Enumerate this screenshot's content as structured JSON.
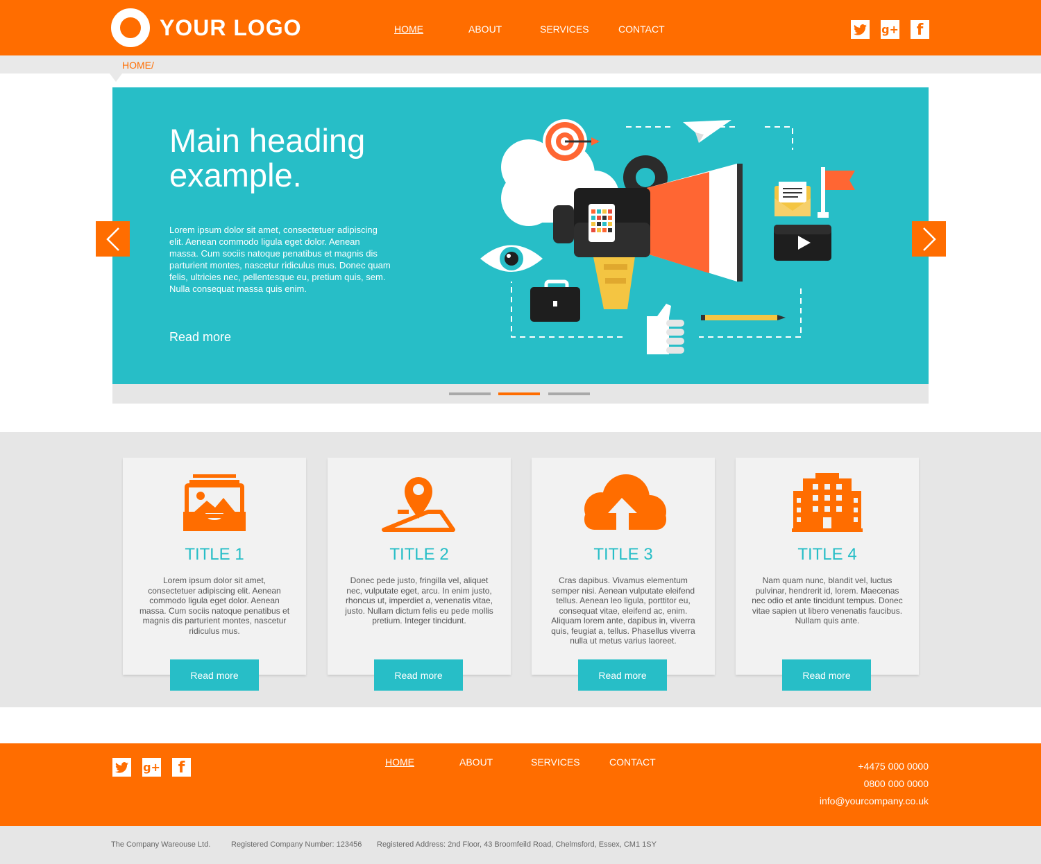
{
  "header": {
    "logo_text": "YOUR LOGO",
    "nav": [
      "HOME",
      "ABOUT",
      "SERVICES",
      "CONTACT"
    ],
    "social_icons": [
      "twitter-icon",
      "google-plus-icon",
      "facebook-icon"
    ]
  },
  "breadcrumb": "HOME/",
  "hero": {
    "heading": "Main heading example.",
    "body": "Lorem ipsum dolor sit amet, consectetuer adipiscing elit. Aenean commodo ligula eget dolor. Aenean massa. Cum sociis natoque penatibus et magnis dis parturient montes, nascetur ridiculus mus. Donec quam felis, ultricies nec, pellentesque eu, pretium quis, sem. Nulla consequat massa quis enim.",
    "read_more": "Read more",
    "slide_count": 3,
    "active_slide": 2
  },
  "features": [
    {
      "title": "TITLE 1",
      "text": "Lorem ipsum dolor sit amet, consectetuer adipiscing elit. Aenean commodo ligula eget dolor. Aenean massa. Cum sociis natoque penatibus et magnis dis parturient montes, nascetur ridiculus mus.",
      "button": "Read more",
      "icon": "photo-archive-icon"
    },
    {
      "title": "TITLE 2",
      "text": "Donec pede justo, fringilla vel, aliquet nec, vulputate eget, arcu. In enim justo, rhoncus ut, imperdiet a, venenatis vitae, justo. Nullam dictum felis eu pede mollis pretium. Integer tincidunt.",
      "button": "Read more",
      "icon": "map-pin-icon"
    },
    {
      "title": "TITLE 3",
      "text": "Cras dapibus. Vivamus elementum semper nisi. Aenean vulputate eleifend tellus. Aenean leo ligula, porttitor eu, consequat vitae, eleifend ac, enim. Aliquam lorem ante, dapibus in, viverra quis, feugiat a, tellus. Phasellus viverra nulla ut metus varius laoreet.",
      "button": "Read more",
      "icon": "cloud-upload-icon"
    },
    {
      "title": "TITLE 4",
      "text": "Nam quam nunc, blandit vel, luctus pulvinar, hendrerit id, lorem. Maecenas nec odio et ante tincidunt tempus. Donec vitae sapien ut libero venenatis faucibus. Nullam quis ante.",
      "button": "Read more",
      "icon": "building-icon"
    }
  ],
  "footer": {
    "nav": [
      "HOME",
      "ABOUT",
      "SERVICES",
      "CONTACT"
    ],
    "phone1": "+4475 000 0000",
    "phone2": "0800 000 0000",
    "email": "info@yourcompany.co.uk"
  },
  "legal": {
    "company": "The Company Wareouse Ltd.",
    "number": "Registered Company Number: 123456",
    "address": "Registered Address: 2nd Floor, 43 Broomfeild Road, Chelmsford, Essex, CM1 1SY"
  },
  "colors": {
    "accent": "#ff6d00",
    "teal": "#27bec7",
    "gray": "#e6e6e6"
  }
}
